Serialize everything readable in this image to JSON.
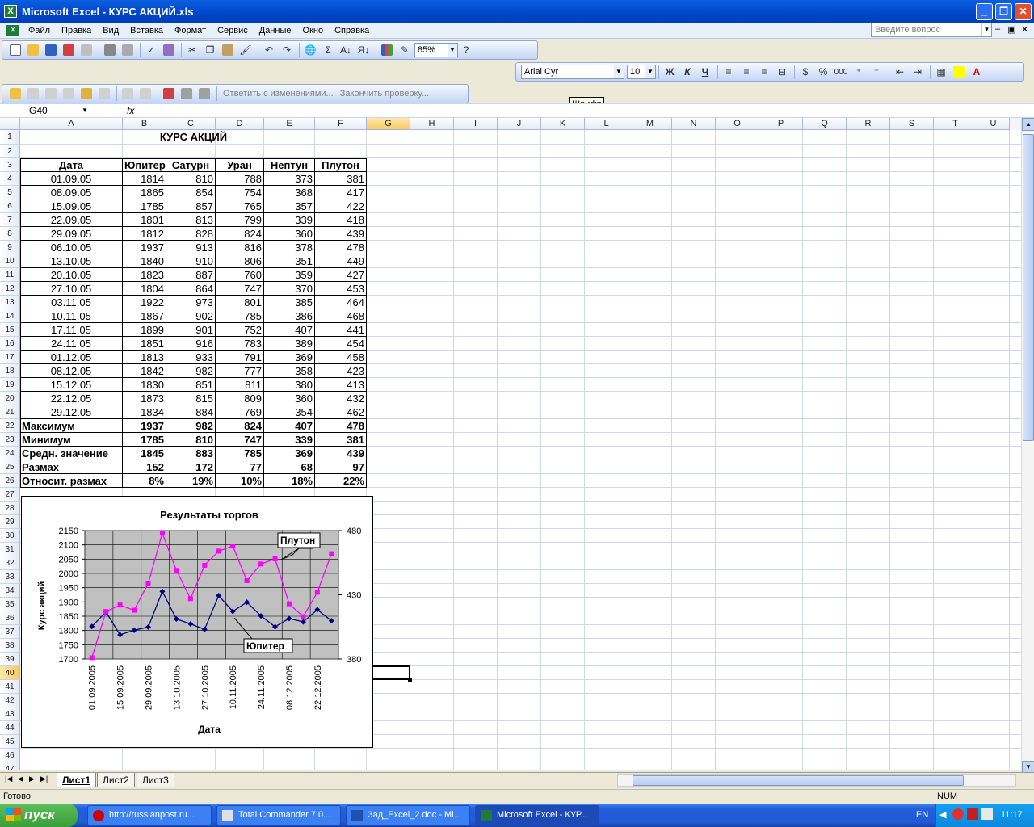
{
  "window": {
    "title": "Microsoft Excel - КУРС АКЦИЙ.xls"
  },
  "menu": [
    "Файл",
    "Правка",
    "Вид",
    "Вставка",
    "Формат",
    "Сервис",
    "Данные",
    "Окно",
    "Справка"
  ],
  "help_placeholder": "Введите вопрос",
  "toolbar": {
    "zoom": "85%",
    "font": "Arial Cyr",
    "size": "10",
    "bold": "Ж",
    "italic": "К",
    "underline": "Ч",
    "percent": "%",
    "thousands": "000",
    "reply_changes": "Ответить с изменениями...",
    "end_review": "Закончить проверку..."
  },
  "tooltip": "Шрифт",
  "namebox": "G40",
  "fx": "fx",
  "columns": [
    "A",
    "B",
    "C",
    "D",
    "E",
    "F",
    "G",
    "H",
    "I",
    "J",
    "K",
    "L",
    "M",
    "N",
    "O",
    "P",
    "Q",
    "R",
    "S",
    "T",
    "U"
  ],
  "selected_column": "G",
  "selected_row": 40,
  "sheet_title": "КУРС АКЦИЙ",
  "headers": [
    "Дата",
    "Юпитер",
    "Сатурн",
    "Уран",
    "Нептун",
    "Плутон"
  ],
  "rows": [
    [
      "01.09.05",
      "1814",
      "810",
      "788",
      "373",
      "381"
    ],
    [
      "08.09.05",
      "1865",
      "854",
      "754",
      "368",
      "417"
    ],
    [
      "15.09.05",
      "1785",
      "857",
      "765",
      "357",
      "422"
    ],
    [
      "22.09.05",
      "1801",
      "813",
      "799",
      "339",
      "418"
    ],
    [
      "29.09.05",
      "1812",
      "828",
      "824",
      "360",
      "439"
    ],
    [
      "06.10.05",
      "1937",
      "913",
      "816",
      "378",
      "478"
    ],
    [
      "13.10.05",
      "1840",
      "910",
      "806",
      "351",
      "449"
    ],
    [
      "20.10.05",
      "1823",
      "887",
      "760",
      "359",
      "427"
    ],
    [
      "27.10.05",
      "1804",
      "864",
      "747",
      "370",
      "453"
    ],
    [
      "03.11.05",
      "1922",
      "973",
      "801",
      "385",
      "464"
    ],
    [
      "10.11.05",
      "1867",
      "902",
      "785",
      "386",
      "468"
    ],
    [
      "17.11.05",
      "1899",
      "901",
      "752",
      "407",
      "441"
    ],
    [
      "24.11.05",
      "1851",
      "916",
      "783",
      "389",
      "454"
    ],
    [
      "01.12.05",
      "1813",
      "933",
      "791",
      "369",
      "458"
    ],
    [
      "08.12.05",
      "1842",
      "982",
      "777",
      "358",
      "423"
    ],
    [
      "15.12.05",
      "1830",
      "851",
      "811",
      "380",
      "413"
    ],
    [
      "22.12.05",
      "1873",
      "815",
      "809",
      "360",
      "432"
    ],
    [
      "29.12.05",
      "1834",
      "884",
      "769",
      "354",
      "462"
    ]
  ],
  "stats": [
    [
      "Максимум",
      "1937",
      "982",
      "824",
      "407",
      "478"
    ],
    [
      "Минимум",
      "1785",
      "810",
      "747",
      "339",
      "381"
    ],
    [
      "Средн. значение",
      "1845",
      "883",
      "785",
      "369",
      "439"
    ],
    [
      "Размах",
      "152",
      "172",
      "77",
      "68",
      "97"
    ],
    [
      "Относит. размах",
      "8%",
      "19%",
      "10%",
      "18%",
      "22%"
    ]
  ],
  "chart_data": {
    "type": "line",
    "title": "Результаты торгов",
    "ylabel": "Курс акций",
    "xlabel": "Дата",
    "x_tick_labels": [
      "01.09.2005",
      "15.09.2005",
      "29.09.2005",
      "13.10.2005",
      "27.10.2005",
      "10.11.2005",
      "24.11.2005",
      "08.12.2005",
      "22.12.2005"
    ],
    "x": [
      "01.09.2005",
      "08.09.2005",
      "15.09.2005",
      "22.09.2005",
      "29.09.2005",
      "06.10.2005",
      "13.10.2005",
      "20.10.2005",
      "27.10.2005",
      "03.11.2005",
      "10.11.2005",
      "17.11.2005",
      "24.11.2005",
      "01.12.2005",
      "08.12.2005",
      "15.12.2005",
      "22.12.2005",
      "29.12.2005"
    ],
    "ylim": [
      1700,
      2150
    ],
    "y_ticks": [
      1700,
      1750,
      1800,
      1850,
      1900,
      1950,
      2000,
      2050,
      2100,
      2150
    ],
    "y2lim": [
      380,
      480
    ],
    "y2_ticks": [
      380,
      430,
      480
    ],
    "grid": true,
    "plot_bg": "#C0C0C0",
    "series": [
      {
        "name": "Юпитер",
        "axis": "left",
        "color": "#000080",
        "marker": "diamond",
        "values": [
          1814,
          1865,
          1785,
          1801,
          1812,
          1937,
          1840,
          1823,
          1804,
          1922,
          1867,
          1899,
          1851,
          1813,
          1842,
          1830,
          1873,
          1834
        ]
      },
      {
        "name": "Плутон",
        "axis": "right",
        "color": "#FF00FF",
        "marker": "square",
        "values": [
          381,
          417,
          422,
          418,
          439,
          478,
          449,
          427,
          453,
          464,
          468,
          441,
          454,
          458,
          423,
          413,
          432,
          462
        ]
      }
    ]
  },
  "sheets": [
    "Лист1",
    "Лист2",
    "Лист3"
  ],
  "active_sheet": "Лист1",
  "status": "Готово",
  "status_num": "NUM",
  "taskbar": {
    "start": "пуск",
    "tasks": [
      "http://russianpost.ru...",
      "Total Commander 7.0...",
      "Зад_Excel_2.doc - Mi...",
      "Microsoft Excel - КУР..."
    ],
    "lang": "EN",
    "clock": "11:17"
  }
}
